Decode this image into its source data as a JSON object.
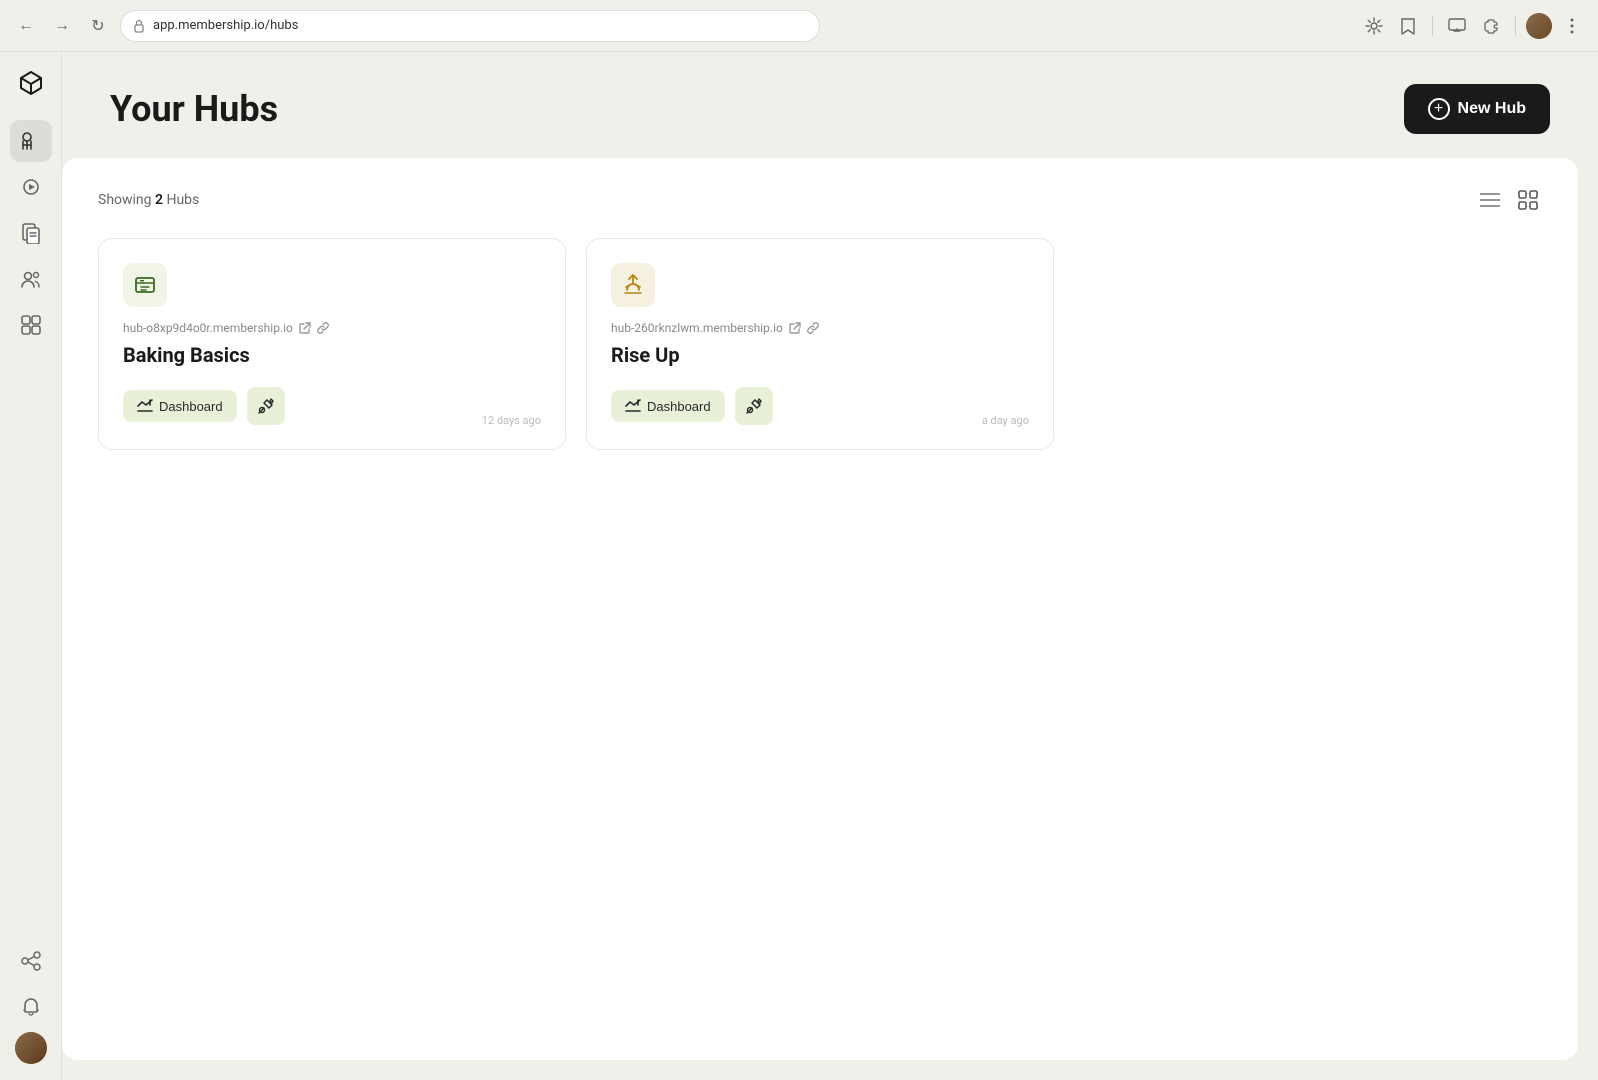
{
  "browser": {
    "address": "app.membership.io/hubs",
    "address_icon": "🔒"
  },
  "page": {
    "title": "Your Hubs",
    "new_hub_label": "New Hub",
    "showing_prefix": "Showing",
    "showing_count": "2",
    "showing_suffix": "Hubs"
  },
  "hubs": [
    {
      "id": "hub-1",
      "icon": "📋",
      "url": "hub-o8xp9d4o0r.membership.io",
      "title": "Baking Basics",
      "dashboard_label": "Dashboard",
      "timestamp": "12 days ago"
    },
    {
      "id": "hub-2",
      "icon": "✂️",
      "url": "hub-260rknzlwm.membership.io",
      "title": "Rise Up",
      "dashboard_label": "Dashboard",
      "timestamp": "a day ago"
    }
  ],
  "sidebar": {
    "nav_items": [
      {
        "name": "hubs",
        "label": "Hubs"
      },
      {
        "name": "content",
        "label": "Content"
      },
      {
        "name": "pages",
        "label": "Pages"
      },
      {
        "name": "members",
        "label": "Members"
      },
      {
        "name": "apps",
        "label": "Apps"
      }
    ],
    "bottom_items": [
      {
        "name": "affiliates",
        "label": "Affiliates"
      },
      {
        "name": "notifications",
        "label": "Notifications"
      }
    ]
  }
}
